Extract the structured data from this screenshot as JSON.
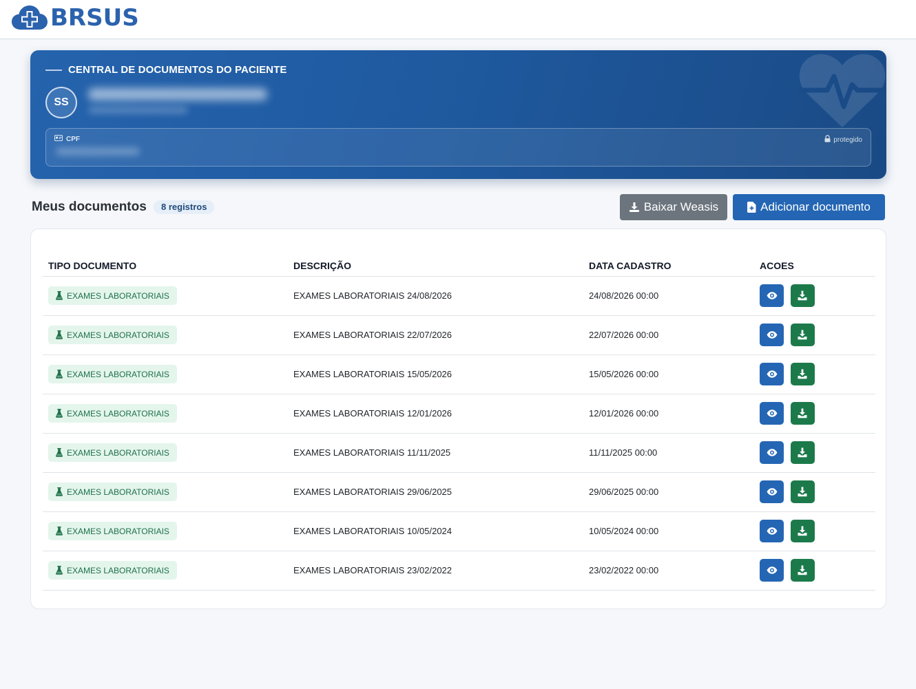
{
  "brand": {
    "name": "BRSUS",
    "logo_icon": "cloud-plus-icon"
  },
  "hero": {
    "title": "CENTRAL DE DOCUMENTOS DO PACIENTE",
    "avatar_initials": "SS",
    "cpf_label": "CPF",
    "protected_label": "protegido"
  },
  "documents": {
    "title": "Meus documentos",
    "count_label": "8 registros",
    "weasis_button": "Baixar Weasis",
    "add_button": "Adicionar documento"
  },
  "table": {
    "headers": [
      "TIPO DOCUMENTO",
      "DESCRIÇÃO",
      "DATA CADASTRO",
      "ACOES"
    ],
    "rows": [
      {
        "type": "EXAMES LABORATORIAIS",
        "description": "EXAMES LABORATORIAIS 24/08/2026",
        "date": "24/08/2026 00:00"
      },
      {
        "type": "EXAMES LABORATORIAIS",
        "description": "EXAMES LABORATORIAIS 22/07/2026",
        "date": "22/07/2026 00:00"
      },
      {
        "type": "EXAMES LABORATORIAIS",
        "description": "EXAMES LABORATORIAIS 15/05/2026",
        "date": "15/05/2026 00:00"
      },
      {
        "type": "EXAMES LABORATORIAIS",
        "description": "EXAMES LABORATORIAIS 12/01/2026",
        "date": "12/01/2026 00:00"
      },
      {
        "type": "EXAMES LABORATORIAIS",
        "description": "EXAMES LABORATORIAIS 11/11/2025",
        "date": "11/11/2025 00:00"
      },
      {
        "type": "EXAMES LABORATORIAIS",
        "description": "EXAMES LABORATORIAIS 29/06/2025",
        "date": "29/06/2025 00:00"
      },
      {
        "type": "EXAMES LABORATORIAIS",
        "description": "EXAMES LABORATORIAIS 10/05/2024",
        "date": "10/05/2024 00:00"
      },
      {
        "type": "EXAMES LABORATORIAIS",
        "description": "EXAMES LABORATORIAIS 23/02/2022",
        "date": "23/02/2022 00:00"
      }
    ]
  },
  "colors": {
    "primary": "#2466b4",
    "success": "#1c7a4a",
    "secondary": "#6c757d",
    "badge_bg": "#e4f5ec",
    "badge_text": "#1d7048"
  }
}
